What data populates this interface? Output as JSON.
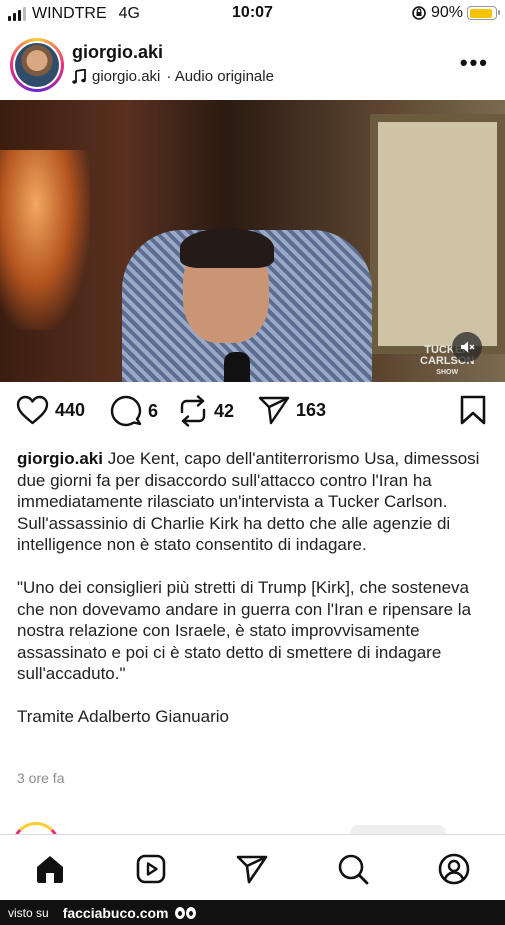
{
  "status_bar": {
    "carrier": "WINDTRE",
    "network": "4G",
    "time": "10:07",
    "battery": "90%",
    "battery_level": 0.9,
    "battery_color": "#f5c300"
  },
  "post": {
    "username": "giorgio.aki",
    "audio_owner": "giorgio.aki",
    "audio_label": "· Audio originale",
    "likes": "440",
    "comments": "6",
    "reposts": "42",
    "shares": "163",
    "caption_user": "giorgio.aki",
    "caption_p1": "Joe Kent, capo dell'antiterrorismo Usa, dimessosi due giorni fa per disaccordo sull'attacco contro l'Iran ha immediatamente rilasciato un'intervista a Tucker Carlson. Sull'assassinio di Charlie Kirk ha detto che alle agenzie di intelligence non è stato consentito di indagare.",
    "caption_p2": "\"Uno dei consiglieri più stretti di Trump [Kirk], che sosteneva che non dovevamo andare in guerra con l'Iran e ripensare la nostra relazione con Israele, è stato improvvisamente assassinato e poi ci è stato detto di smettere di indagare sull'accaduto.\"",
    "caption_p3": "Tramite Adalberto Gianuario",
    "time_ago": "3 ore fa",
    "video_logo_line1": "TUCKER",
    "video_logo_line2": "CARLSON",
    "video_logo_line3": "SHOW"
  },
  "icons": {
    "like": "heart-icon",
    "comment": "comment-icon",
    "repost": "repost-icon",
    "share": "send-icon",
    "save": "bookmark-icon",
    "mute": "speaker-muted-icon",
    "nav": [
      "home-icon",
      "reels-icon",
      "send-icon",
      "search-icon",
      "profile-icon"
    ]
  },
  "watermark": {
    "prefix": "visto su",
    "brand": "facciabuco.com"
  }
}
